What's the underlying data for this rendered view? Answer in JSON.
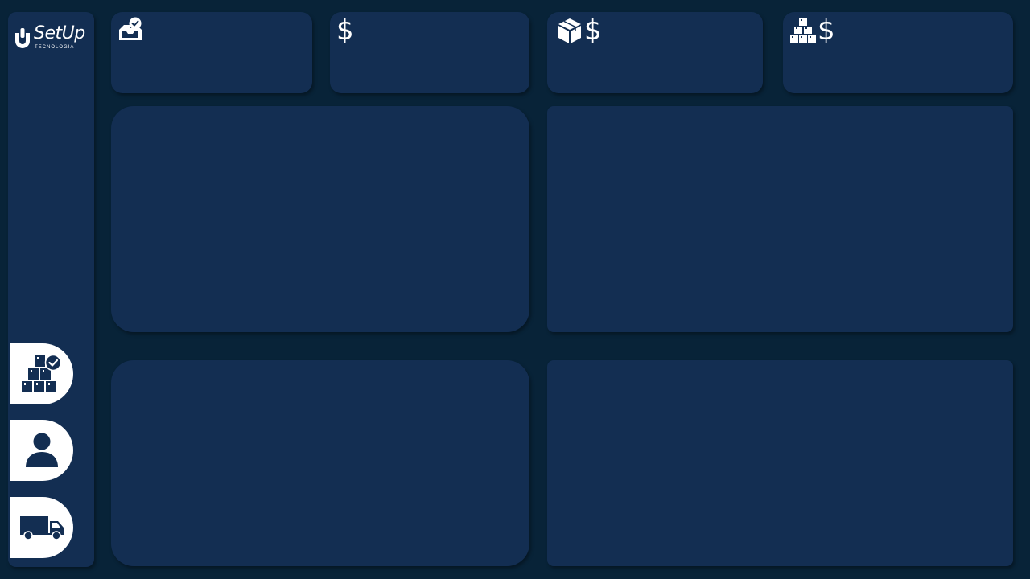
{
  "brand": {
    "name": "SetUp",
    "tagline": "TECNOLOGIA"
  },
  "colors": {
    "background": "#082338",
    "panel": "#132e52",
    "accent": "#ffffff"
  },
  "sidebar": {
    "items": [
      {
        "icon": "boxes-check-icon"
      },
      {
        "icon": "user-icon"
      },
      {
        "icon": "truck-icon"
      }
    ]
  },
  "kpis": [
    {
      "icons": [
        "inbox-check-icon"
      ]
    },
    {
      "icons": [
        "dollar-icon"
      ],
      "symbol": "$"
    },
    {
      "icons": [
        "box-icon",
        "dollar-icon"
      ],
      "symbol": "$"
    },
    {
      "icons": [
        "boxes-icon",
        "dollar-icon"
      ],
      "symbol": "$"
    }
  ]
}
